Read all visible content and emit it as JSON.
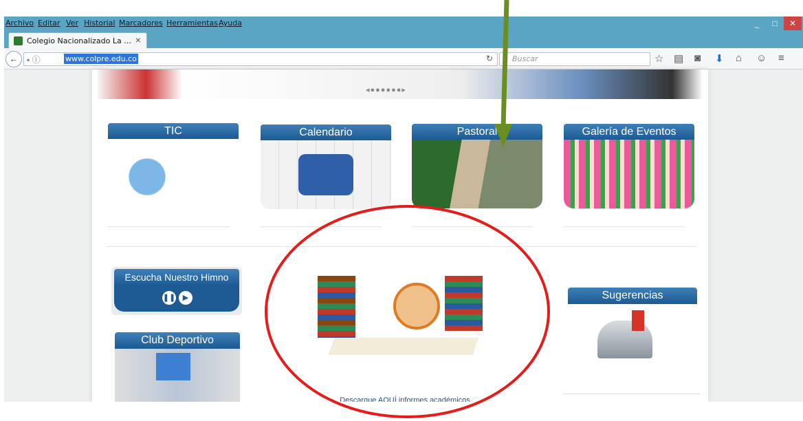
{
  "browser": {
    "menu": [
      "Archivo",
      "Editar",
      "Ver",
      "Historial",
      "Marcadores",
      "Herramientas",
      "Ayuda"
    ],
    "tab_title": "Colegio Nacionalizado La ...",
    "url": "www.colpre.edu.co",
    "search_placeholder": "Buscar",
    "window_controls": [
      "_",
      "□",
      "✕"
    ]
  },
  "cards": [
    {
      "title": "TIC"
    },
    {
      "title": "Calendario"
    },
    {
      "title": "Pastoral"
    },
    {
      "title": "Galería de Eventos"
    }
  ],
  "left_widgets": {
    "anthem_title": "Escucha Nuestro Himno",
    "club_title": "Club Deportivo"
  },
  "center": {
    "download_text": "Descargue AQUÍ informes académicos"
  },
  "right_widgets": {
    "suggestions_title": "Sugerencias"
  },
  "annotation": {
    "circle_color": "#e41c1c",
    "arrow_color": "#6b8e23"
  }
}
